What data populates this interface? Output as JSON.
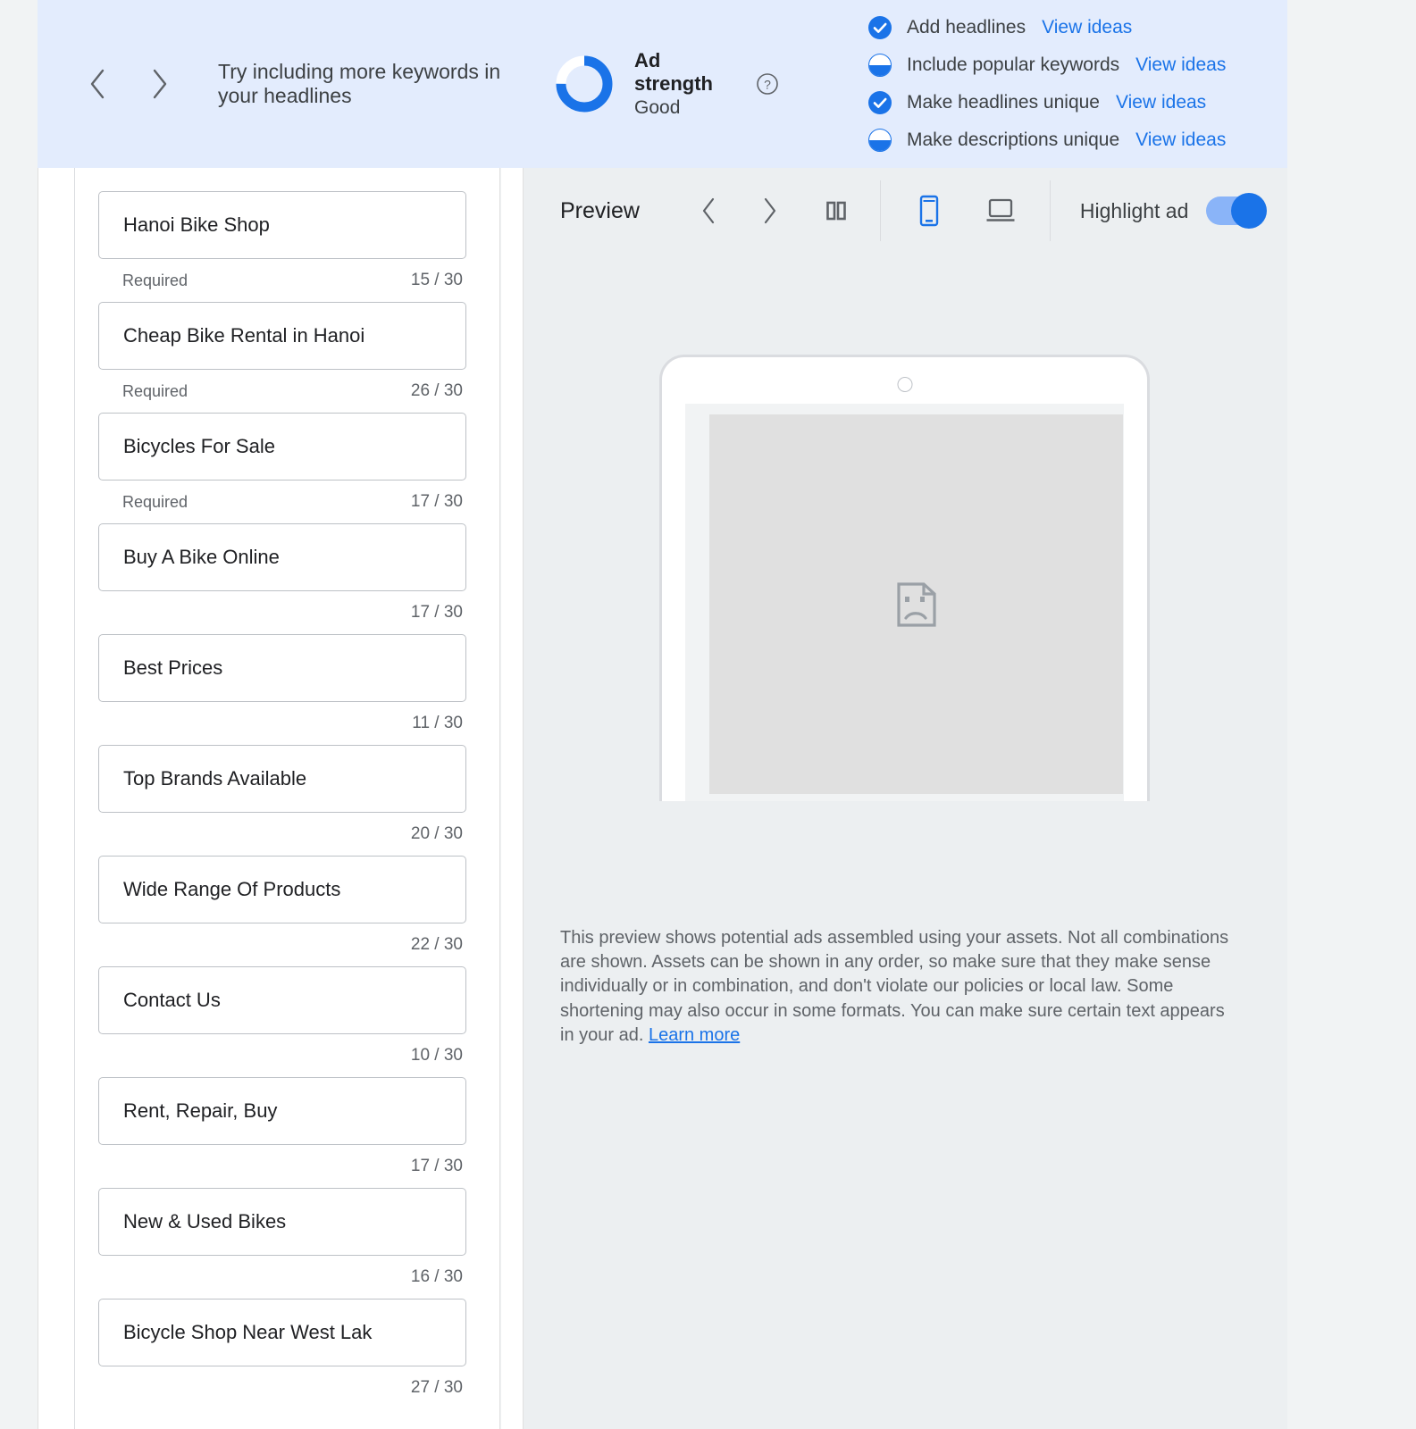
{
  "banner": {
    "prev_icon": "chevron-left-icon",
    "next_icon": "chevron-right-icon",
    "tip_text": "Try including more keywords in your headlines",
    "ad_strength": {
      "label": "Ad strength",
      "value": "Good",
      "percent": 75,
      "ring_color": "#1a73e8",
      "track_color": "#ffffff",
      "help_icon": "help-circle-icon"
    },
    "checklist": [
      {
        "state": "complete",
        "label": "Add headlines",
        "action": "View ideas"
      },
      {
        "state": "partial",
        "label": "Include popular keywords",
        "action": "View ideas"
      },
      {
        "state": "complete",
        "label": "Make headlines unique",
        "action": "View ideas"
      },
      {
        "state": "partial",
        "label": "Make descriptions unique",
        "action": "View ideas"
      }
    ],
    "background_color": "#e3ecfd",
    "link_color": "#1a73e8"
  },
  "headlines": [
    {
      "value": "Hanoi Bike Shop",
      "required_label": "Required",
      "count": "15 / 30"
    },
    {
      "value": "Cheap Bike Rental in Hanoi",
      "required_label": "Required",
      "count": "26 / 30"
    },
    {
      "value": "Bicycles For Sale",
      "required_label": "Required",
      "count": "17 / 30"
    },
    {
      "value": "Buy A Bike Online",
      "required_label": "",
      "count": "17 / 30"
    },
    {
      "value": "Best Prices",
      "required_label": "",
      "count": "11 / 30"
    },
    {
      "value": "Top Brands Available",
      "required_label": "",
      "count": "20 / 30"
    },
    {
      "value": "Wide Range Of Products",
      "required_label": "",
      "count": "22 / 30"
    },
    {
      "value": "Contact Us",
      "required_label": "",
      "count": "10 / 30"
    },
    {
      "value": "Rent, Repair, Buy",
      "required_label": "",
      "count": "17 / 30"
    },
    {
      "value": "New & Used Bikes",
      "required_label": "",
      "count": "16 / 30"
    },
    {
      "value": "Bicycle Shop Near West Lak",
      "required_label": "",
      "count": "27 / 30"
    }
  ],
  "preview": {
    "title": "Preview",
    "prev_icon": "chevron-left-icon",
    "next_icon": "chevron-right-icon",
    "pause_icon": "pause-icon",
    "mobile_icon": "mobile-device-icon",
    "desktop_icon": "desktop-device-icon",
    "mobile_selected": true,
    "highlight_label": "Highlight ad",
    "highlight_on": true,
    "placeholder_icon": "broken-document-icon",
    "disclaimer_text": "This preview shows potential ads assembled using your assets. Not all combinations are shown. Assets can be shown in any order, so make sure that they make sense individually or in combination, and don't violate our policies or local law. Some shortening may also occur in some formats. You can make sure certain text appears in your ad. ",
    "learn_more": "Learn more",
    "accent_color": "#1a73e8"
  }
}
